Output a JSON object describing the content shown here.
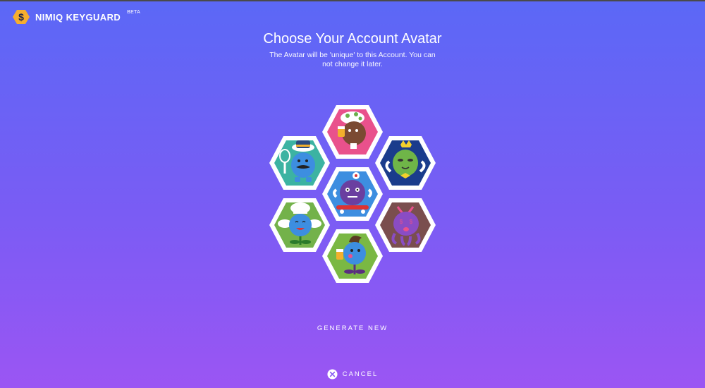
{
  "header": {
    "brand_name": "NIMIQ KEYGUARD",
    "brand_badge": "BETA",
    "logo_icon": "nimiq-hexagon-logo"
  },
  "main": {
    "title": "Choose Your Account Avatar",
    "subtitle": "The Avatar will be 'unique' to this Account. You can not change it later."
  },
  "avatars": [
    {
      "name": "avatar-beer-mushroom-hat",
      "bg": "#e9518c"
    },
    {
      "name": "avatar-tennis-mustache",
      "bg": "#3cb3a2"
    },
    {
      "name": "avatar-horned-crown",
      "bg": "#1a3c8c"
    },
    {
      "name": "avatar-skateboard-horned",
      "bg": "#3d8ee0"
    },
    {
      "name": "avatar-chef-wings",
      "bg": "#73b24a"
    },
    {
      "name": "avatar-purple-dollar-eyes",
      "bg": "#7a4e4e"
    },
    {
      "name": "avatar-beer-pompadour",
      "bg": "#7ab843"
    }
  ],
  "actions": {
    "generate_label": "GENERATE NEW",
    "cancel_label": "CANCEL"
  },
  "colors": {
    "gradient_top": "#5b68f6",
    "gradient_bottom": "#9b55f3",
    "logo_gold": "#f6ae2d"
  }
}
